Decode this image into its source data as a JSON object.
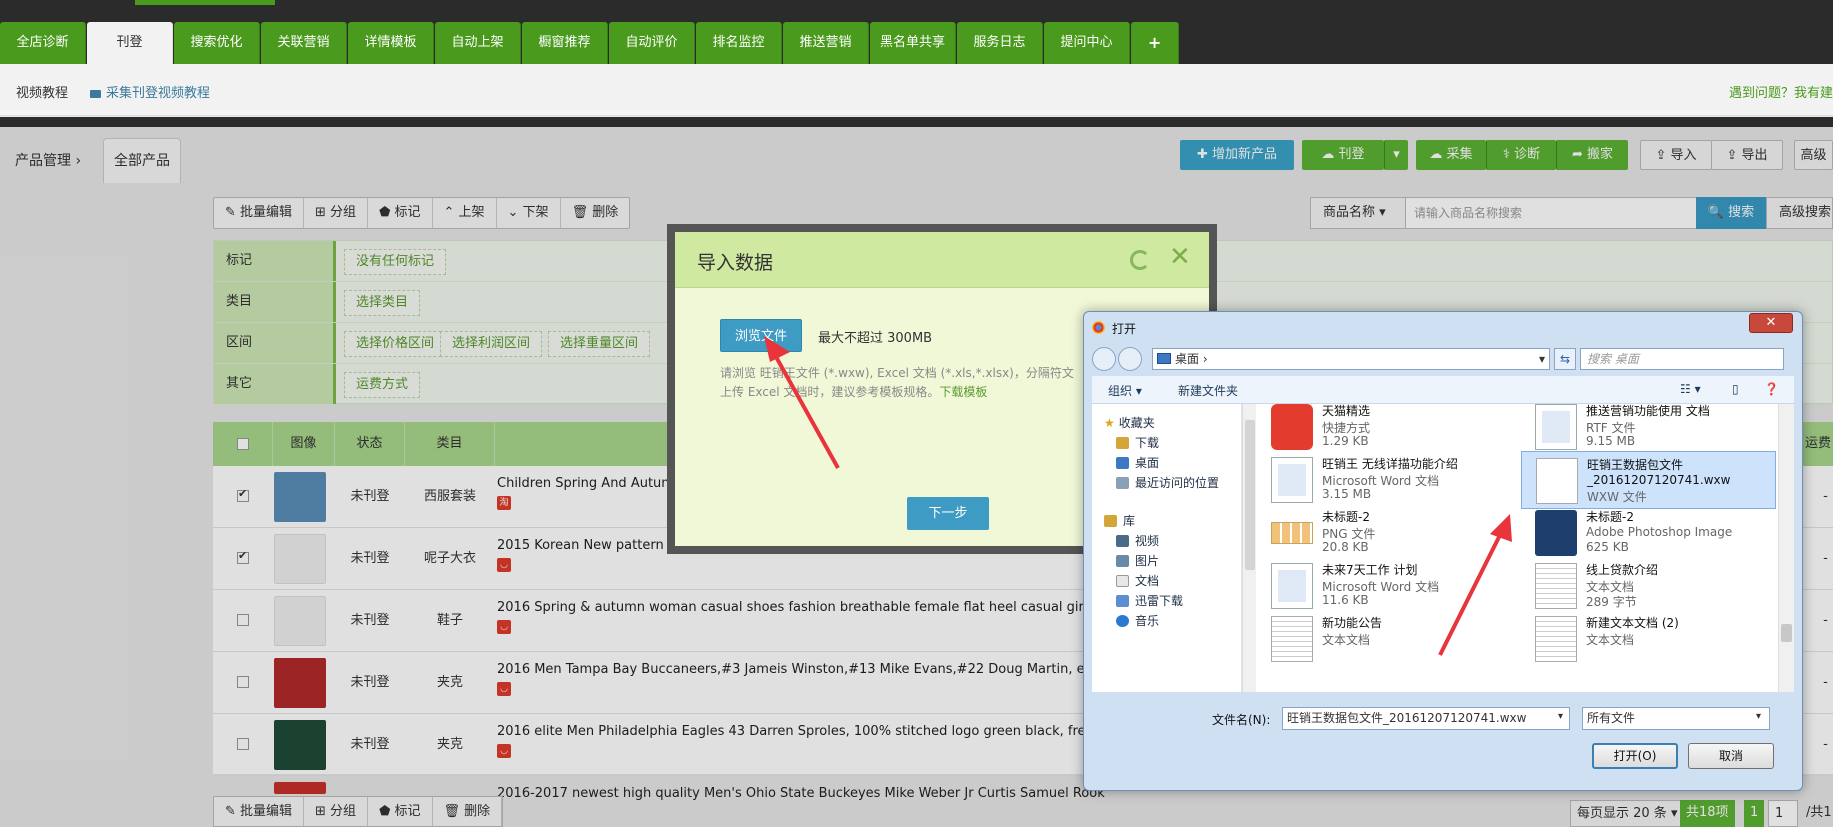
{
  "top_tabs": [
    "全店诊断",
    "刊登",
    "搜索优化",
    "关联营销",
    "详情模板",
    "自动上架",
    "橱窗推荐",
    "自动评价",
    "排名监控",
    "推送营销",
    "黑名单共享",
    "服务日志",
    "提问中心",
    "+"
  ],
  "active_tab": "刊登",
  "subbar": {
    "video_tutorial": "视频教程",
    "collect_tutorial": "采集刊登视频教程",
    "help": "遇到问题？我有建"
  },
  "breadcrumb": {
    "root": "产品管理",
    "sep": "›",
    "current": "全部产品"
  },
  "actions": {
    "add_product": "✚ 增加新产品",
    "publish": "☁ 刊登",
    "collect": "☁ 采集",
    "diagnose": "⚕ 诊断",
    "move": "➦ 搬家",
    "import": "⇪ 导入",
    "export": "⇪ 导出",
    "advanced": "高级"
  },
  "toolbar": [
    "✎ 批量编辑",
    "⊞ 分组",
    "⬟ 标记",
    "⌃ 上架",
    "⌄ 下架",
    "🗑 删除"
  ],
  "search": {
    "field": "商品名称 ▾",
    "placeholder": "请输入商品名称搜索",
    "button": "🔍 搜索",
    "advanced": "高级搜索"
  },
  "filters": [
    {
      "label": "标记",
      "chips": [
        "没有任何标记"
      ]
    },
    {
      "label": "类目",
      "chips": [
        "选择类目"
      ]
    },
    {
      "label": "区间",
      "chips": [
        "选择价格区间",
        "选择利润区间",
        "选择重量区间"
      ]
    },
    {
      "label": "其它",
      "chips": [
        "运费方式"
      ]
    }
  ],
  "table": {
    "headers": [
      "",
      "图像",
      "状态",
      "类目",
      "",
      "运费"
    ],
    "rows": [
      {
        "checked": true,
        "status": "未刊登",
        "category": "西服套装",
        "title": "Children Spring And Autumn",
        "badge": "淘"
      },
      {
        "checked": true,
        "status": "未刊登",
        "category": "呢子大衣",
        "title": "2015 Korean New pattern Winter clothes Woollen overcoat Slim Temperament Long Paragraph",
        "badge": "◡"
      },
      {
        "checked": false,
        "status": "未刊登",
        "category": "鞋子",
        "title": "2016 Spring & autumn woman casual shoes fashion breathable female flat heel casual girl shoe",
        "badge": "◡"
      },
      {
        "checked": false,
        "status": "未刊登",
        "category": "夹克",
        "title": "2016 Men Tampa Bay Buccaneers,#3 Jameis Winston,#13 Mike Evans,#22 Doug Martin, elite Re",
        "badge": "◡"
      },
      {
        "checked": false,
        "status": "未刊登",
        "category": "夹克",
        "title": "2016 elite Men Philadelphia Eagles 43 Darren Sproles, 100% stitched logo green black, free ship",
        "badge": "◡"
      }
    ],
    "row_cell_dash": "-",
    "partial_row_title": "2016-2017 newest high quality Men's Ohio State Buckeyes Mike Weber Jr Curtis Samuel Rook"
  },
  "bottom_toolbar": [
    "✎ 批量编辑",
    "⊞ 分组",
    "⬟ 标记",
    "🗑 删除"
  ],
  "pager": {
    "per_page": "每页显示 20 条 ▾",
    "total": "共18项",
    "page": "1",
    "page_input": "1",
    "total_pages": "/共1"
  },
  "import_modal": {
    "title": "导入数据",
    "browse": "浏览文件",
    "max_size": "最大不超过 300MB",
    "hint_line1": "请浏览 旺销王文件 (*.wxw), Excel 文档 (*.xls,*.xlsx)，分隔符文",
    "hint_line2": "上传 Excel 文档时，建议参考模板规格。",
    "download_template": "下载模板",
    "next": "下一步"
  },
  "file_dialog": {
    "title": "打开",
    "address": "桌面",
    "search_placeholder": "搜索 桌面",
    "organize": "组织 ▾",
    "new_folder": "新建文件夹",
    "nav": {
      "favorites": "收藏夹",
      "downloads": "下载",
      "desktop": "桌面",
      "recent": "最近访问的位置",
      "libraries": "库",
      "videos": "视频",
      "pictures": "图片",
      "documents": "文档",
      "xunlei": "迅雷下载",
      "music": "音乐"
    },
    "files": [
      {
        "name": "天猫精选",
        "type": "快捷方式",
        "size": "1.29 KB",
        "icon": "tmall-icon"
      },
      {
        "name": "推送营销功能使用 文档",
        "type": "RTF 文件",
        "size": "9.15 MB",
        "icon": "word-doc-icon"
      },
      {
        "name": "旺销王 无线详描功能介绍",
        "type": "Microsoft Word 文档",
        "size": "3.15 MB",
        "icon": "word-doc-icon"
      },
      {
        "name": "旺销王数据包文件",
        "name2": "_20161207120741.wxw",
        "type": "WXW 文件",
        "size": "",
        "icon": "blank-file-icon"
      },
      {
        "name": "未标题-2",
        "type": "PNG 文件",
        "size": "20.8 KB",
        "icon": "png-file-icon"
      },
      {
        "name": "未标题-2",
        "type": "Adobe Photoshop Image",
        "size": "625 KB",
        "icon": "psd-file-icon"
      },
      {
        "name": "未来7天工作 计划",
        "type": "Microsoft Word 文档",
        "size": "11.6 KB",
        "icon": "word-doc-icon"
      },
      {
        "name": "线上贷款介绍",
        "type": "文本文档",
        "size": "289 字节",
        "icon": "text-file-icon"
      },
      {
        "name": "新功能公告",
        "type": "文本文档",
        "size": "",
        "icon": "text-file-icon"
      },
      {
        "name": "新建文本文档 (2)",
        "type": "文本文档",
        "size": "",
        "icon": "text-file-icon"
      }
    ],
    "filename_label": "文件名(N):",
    "filename_value": "旺销王数据包文件_20161207120741.wxw",
    "filetype": "所有文件",
    "open": "打开(O)",
    "cancel": "取消"
  },
  "colors": {
    "tab_green": "#4a9a1e",
    "accent_blue": "#3aa3c8",
    "arrow_red": "#e8343a"
  }
}
